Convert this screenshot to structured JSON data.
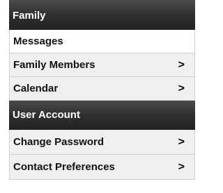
{
  "sections": [
    {
      "title": "Family",
      "items": [
        {
          "label": "Messages",
          "chevron": "",
          "active": true
        },
        {
          "label": "Family Members",
          "chevron": ">"
        },
        {
          "label": "Calendar",
          "chevron": ">"
        }
      ]
    },
    {
      "title": "User Account",
      "items": [
        {
          "label": "Change Password",
          "chevron": ">"
        },
        {
          "label": "Contact Preferences",
          "chevron": ">"
        }
      ]
    }
  ],
  "colors": {
    "header_bg": "#2e2e2e",
    "header_text": "#ffffff",
    "item_bg": "#efefef",
    "item_active_bg": "#ffffff",
    "item_border": "#cfcfcf",
    "item_text": "#111111"
  },
  "icons": {
    "chevron": "chevron-right-icon"
  }
}
